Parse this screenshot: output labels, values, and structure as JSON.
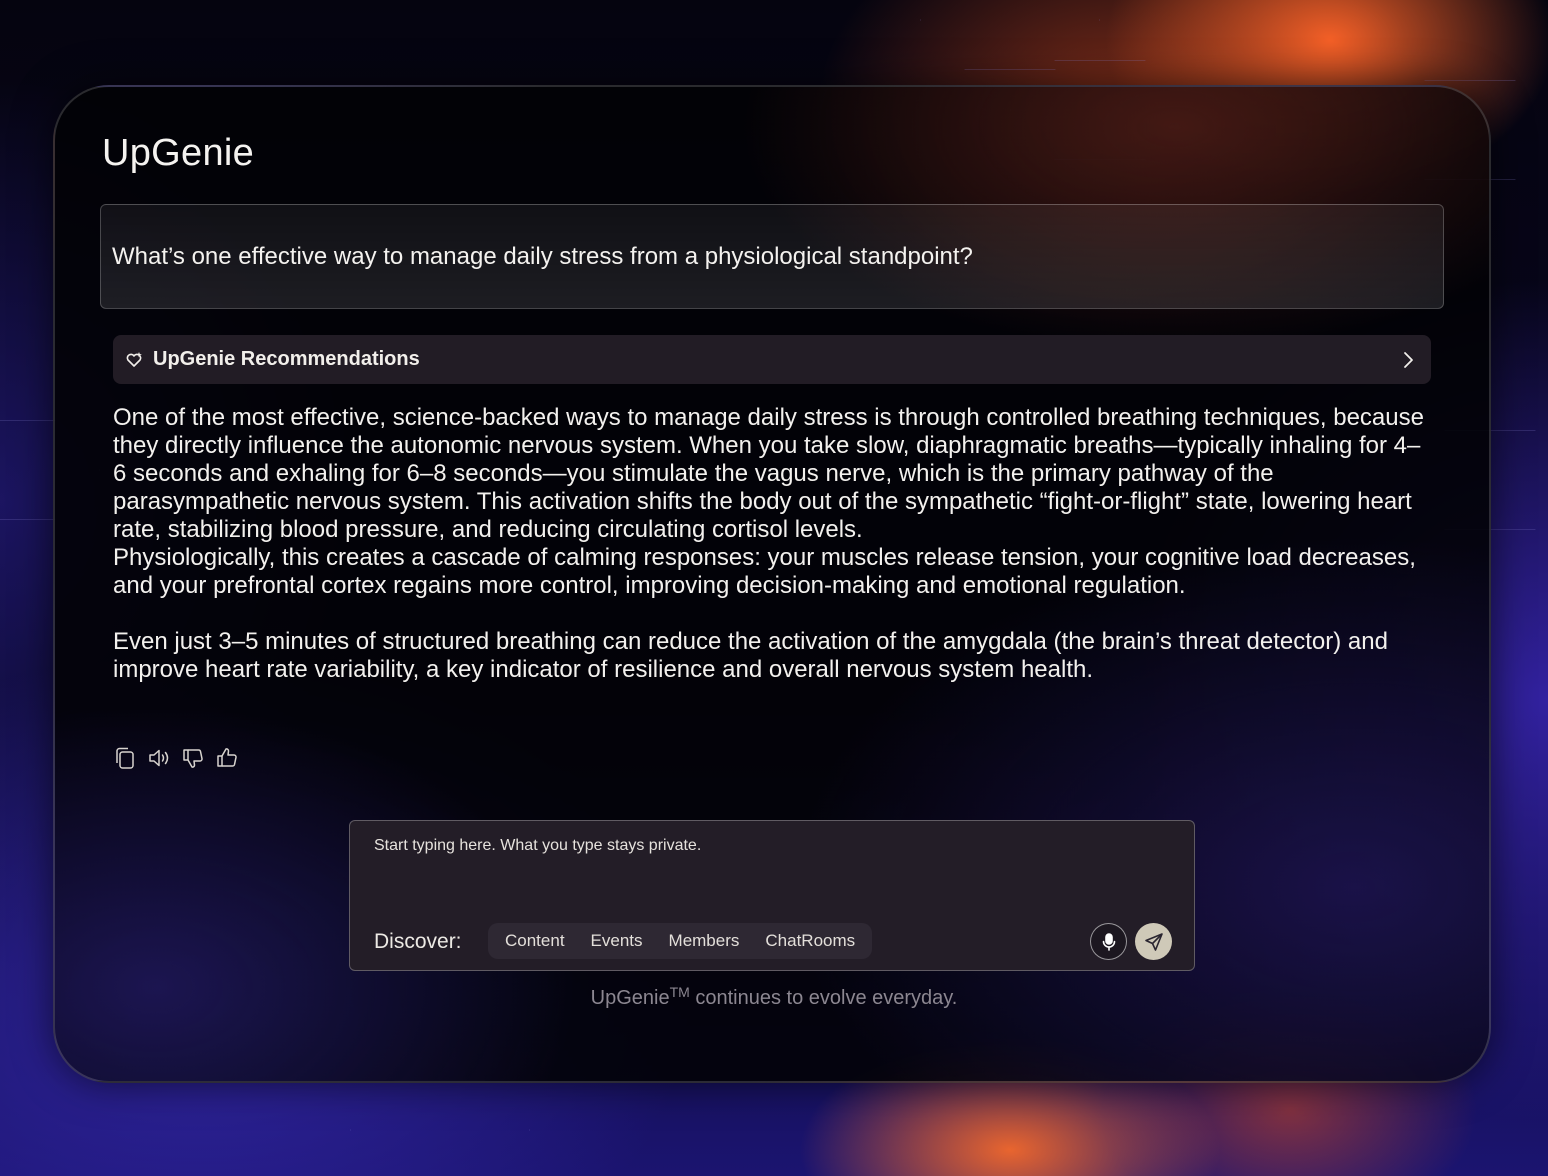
{
  "app": {
    "title": "UpGenie"
  },
  "question": {
    "text": "What’s one effective way to manage daily stress from a physiological standpoint?"
  },
  "recommendations": {
    "label": "UpGenie Recommendations",
    "icon": "sparkle-heart-icon"
  },
  "answer": {
    "paragraph_1": "One of the most effective, science-backed ways to manage daily stress is through controlled breathing techniques, because they directly influence the autonomic nervous system. When you take slow, diaphragmatic breaths—typically inhaling for 4–6 seconds and exhaling for 6–8 seconds—you stimulate the vagus nerve, which is the primary pathway of the parasympathetic nervous system. This activation shifts the body out of the sympathetic “fight-or-flight” state, lowering heart rate, stabilizing blood pressure, and reducing circulating cortisol levels.",
    "paragraph_2": "Physiologically, this creates a cascade of calming responses: your muscles release tension, your cognitive load decreases, and your prefrontal cortex regains more control, improving decision-making and emotional regulation.",
    "paragraph_3": "Even just 3–5 minutes of structured breathing can reduce the activation of the amygdala (the brain’s threat detector) and improve heart rate variability, a key indicator of resilience and overall nervous system health."
  },
  "actions": [
    "copy-icon",
    "speaker-icon",
    "thumbs-down-icon",
    "thumbs-up-icon"
  ],
  "composer": {
    "placeholder": "Start typing here. What you type stays private.",
    "discover_label": "Discover:",
    "chips": [
      "Content",
      "Events",
      "Members",
      "ChatRooms"
    ]
  },
  "footer": {
    "brand": "UpGenie",
    "tm": "TM",
    "text": " continues to evolve everyday."
  },
  "colors": {
    "accent_orange": "#ff6a2a",
    "send_button": "#cfc9b8",
    "panel_bg": "#020206",
    "bar_bg": "#221c25"
  }
}
